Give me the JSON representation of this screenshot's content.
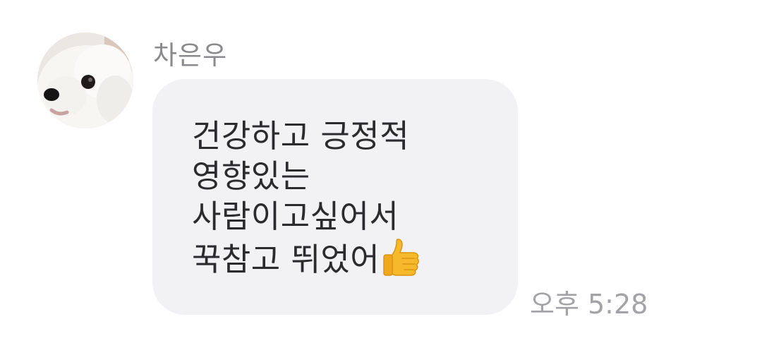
{
  "message": {
    "sender_name": "차은우",
    "lines": [
      "건강하고 긍정적",
      "영향있는",
      "사람이고싶어서",
      "꾹참고 뛰었어"
    ],
    "emoji": "thumbs-up-icon",
    "timestamp": "오후 5:28"
  },
  "colors": {
    "bubble_background": "#f2f2f5",
    "text": "#2b2b2e",
    "sender_name": "#8a8a8e",
    "timestamp": "#a3a3a7"
  }
}
